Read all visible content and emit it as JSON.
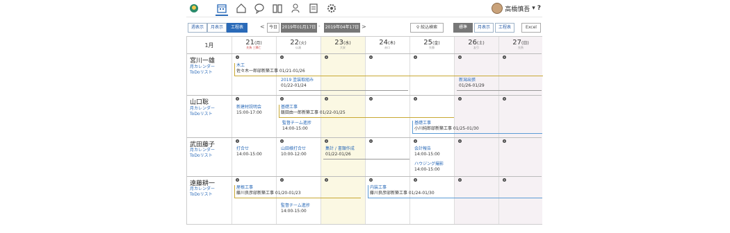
{
  "nav": {
    "icons": [
      "app-logo-icon",
      "calendar-icon",
      "home-icon",
      "chat-icon",
      "book-icon",
      "people-icon",
      "document-icon",
      "settings-icon"
    ],
    "user_name": "高橋慎吾",
    "help": "?"
  },
  "toolbar": {
    "views": [
      "週表示",
      "月表示",
      "工程表"
    ],
    "today": "今日",
    "date_from": "2019年01月17日",
    "date_sep": "-",
    "date_to": "2019年04年17日",
    "search": "絞込検索",
    "modes": [
      "標準",
      "月表示",
      "工程表"
    ],
    "excel": "Excel"
  },
  "calendar": {
    "month": "1月",
    "days": [
      {
        "day": "21",
        "dow": "(月)",
        "sub": "先負 三隣亡"
      },
      {
        "day": "22",
        "dow": "(火)",
        "sub": "仏滅"
      },
      {
        "day": "23",
        "dow": "(水)",
        "sub": "大安"
      },
      {
        "day": "24",
        "dow": "(木)",
        "sub": "赤口"
      },
      {
        "day": "25",
        "dow": "(金)",
        "sub": "先勝"
      },
      {
        "day": "26",
        "dow": "(土)",
        "sub": "友引"
      },
      {
        "day": "27",
        "dow": "(日)",
        "sub": "先負"
      }
    ],
    "people": [
      {
        "name": "宮川一雄",
        "link1": "月カレンダー",
        "link2": "ToDoリスト",
        "events": [
          {
            "title": "木工",
            "detail": "佐々木一郎邸新築工事 01/21-01/26"
          },
          {
            "title": "2019 塗装取組み",
            "detail": "01/22-01/24"
          },
          {
            "title": "新潟出張",
            "detail": "01/26-01/29"
          }
        ]
      },
      {
        "name": "山口聡",
        "link1": "月カレンダー",
        "link2": "ToDoリスト",
        "events": [
          {
            "title": "新建材説明会",
            "detail": "15:00-17:00"
          },
          {
            "title": "基礎工事",
            "detail": "飯田由一郎新築工事 01/22-01/25"
          },
          {
            "title": "監督チーム進捗",
            "detail": "14:00-15:00"
          },
          {
            "title": "基礎工事",
            "detail": "小川純郎邸新築工事 01/25-01/30"
          }
        ]
      },
      {
        "name": "武田藤子",
        "link1": "月カレンダー",
        "link2": "ToDoリスト",
        "events": [
          {
            "title": "打合せ",
            "detail": "14:00-15:00"
          },
          {
            "title": "山田様打合せ",
            "detail": "10:00-12:00"
          },
          {
            "title": "集計 / 書類作成",
            "detail": "01/22-01/26"
          },
          {
            "title": "会計報告",
            "detail": "14:00-15:00"
          },
          {
            "title": "ハウジング撮影",
            "detail": "14:00-15:00"
          }
        ]
      },
      {
        "name": "遠藤耕一",
        "link1": "月カレンダー",
        "link2": "ToDoリスト",
        "events": [
          {
            "title": "屋根工事",
            "detail": "藤川良彦邸新築工事 01/20-01/23"
          },
          {
            "title": "内装工事",
            "detail": "藤川良彦邸新築工事 01/24-01/30"
          },
          {
            "title": "監督チーム進捗",
            "detail": "14:00-15:00"
          }
        ]
      }
    ]
  },
  "colors": {
    "accent": "#2a6ab8",
    "today_bg": "#fbf8e3",
    "weekend_bg": "#f6f1f4",
    "bar_gold": "#c8a832",
    "bar_gray": "#999999",
    "bar_blue": "#5b9bd5"
  }
}
